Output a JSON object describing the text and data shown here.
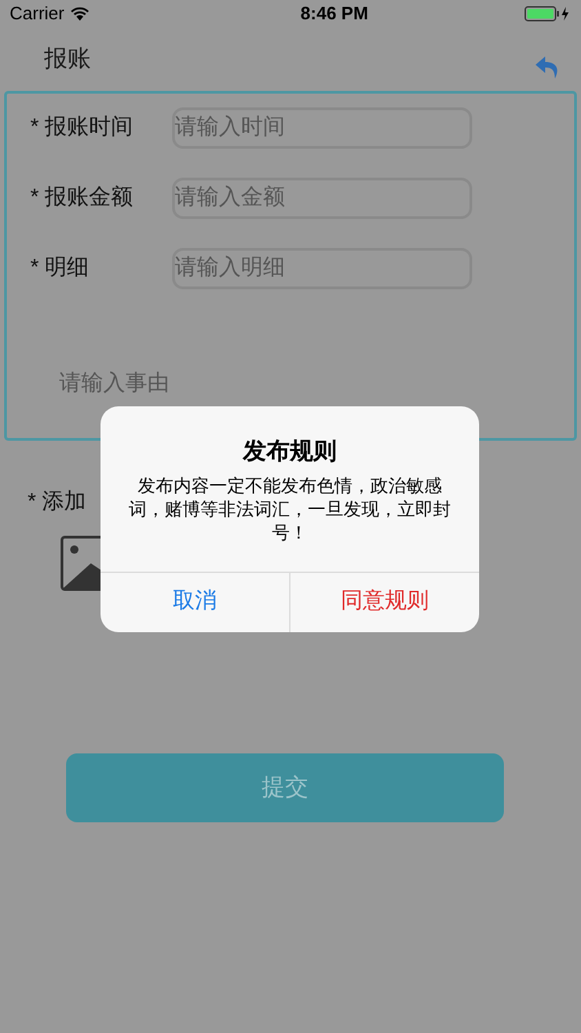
{
  "status_bar": {
    "carrier": "Carrier",
    "time": "8:46 PM"
  },
  "nav": {
    "title": "报账"
  },
  "form": {
    "fields": [
      {
        "label": "* 报账时间",
        "placeholder": "请输入时间"
      },
      {
        "label": "* 报账金额",
        "placeholder": "请输入金额"
      },
      {
        "label": "* 明细",
        "placeholder": "请输入明细"
      }
    ],
    "reason_placeholder": "请输入事由"
  },
  "attachment": {
    "label": "* 添加"
  },
  "submit": "提交",
  "dialog": {
    "title": "发布规则",
    "message": "发布内容一定不能发布色情，政治敏感词，赌博等非法词汇，一旦发现，立即封号！",
    "buttons": [
      {
        "label": "取消",
        "kind": "cancel"
      },
      {
        "label": "同意规则",
        "kind": "confirm"
      }
    ]
  }
}
